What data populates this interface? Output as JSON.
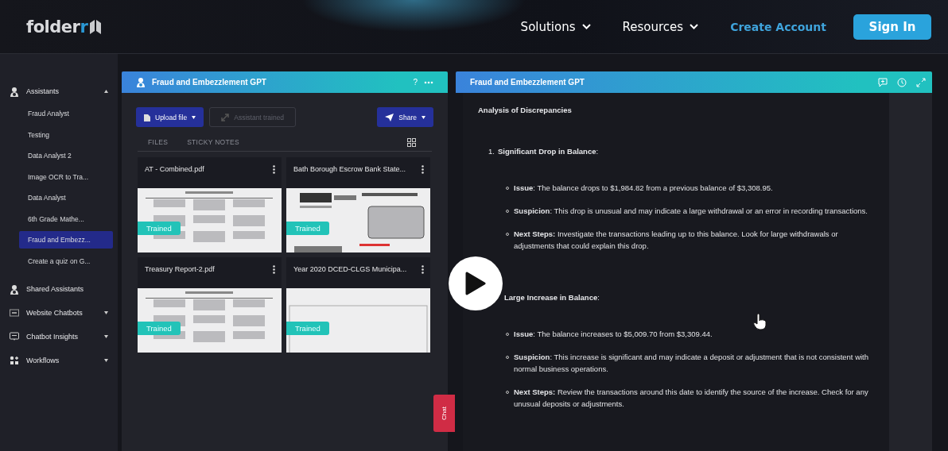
{
  "header": {
    "logo": {
      "text": "folder",
      "accent": "r"
    },
    "nav": [
      {
        "label": "Solutions",
        "dropdown": true
      },
      {
        "label": "Resources",
        "dropdown": true
      }
    ],
    "create_account": "Create Account",
    "sign_in": "Sign In"
  },
  "sidebar": {
    "sections": [
      {
        "label": "Assistants",
        "kind": "person",
        "expanded": true,
        "children": [
          {
            "label": "Fraud Analyst",
            "selected": false
          },
          {
            "label": "Testing",
            "selected": false
          },
          {
            "label": "Data Analyst 2",
            "selected": false
          },
          {
            "label": "Image OCR to Tra...",
            "selected": false
          },
          {
            "label": "Data Analyst",
            "selected": false
          },
          {
            "label": "6th Grade Mathe...",
            "selected": false
          },
          {
            "label": "Fraud and Embezz...",
            "selected": true
          },
          {
            "label": "Create a quiz on G...",
            "selected": false
          }
        ]
      },
      {
        "label": "Shared Assistants",
        "kind": "person"
      },
      {
        "label": "Website Chatbots",
        "kind": "chatbot",
        "expanded": false
      },
      {
        "label": "Chatbot Insights",
        "kind": "insight",
        "expanded": false
      },
      {
        "label": "Workflows",
        "kind": "workflow",
        "expanded": false
      }
    ]
  },
  "left_panel": {
    "title": "Fraud and Embezzlement GPT",
    "help": "?",
    "upload_button": "Upload file",
    "trained_button": {
      "label": "Assistant trained",
      "disabled": true
    },
    "share_button": "Share",
    "tabs": [
      {
        "label": "FILES",
        "selected": false
      },
      {
        "label": "STICKY NOTES",
        "selected": false
      }
    ],
    "files": [
      {
        "name": "AT - Combined.pdf",
        "badge": "Trained"
      },
      {
        "name": "Bath Borough Escrow Bank State...",
        "badge": "Trained"
      },
      {
        "name": "Treasury Report-2.pdf",
        "badge": "Trained"
      },
      {
        "name": "Year 2020 DCED-CLGS Municipa...",
        "badge": "Trained"
      }
    ]
  },
  "right_panel": {
    "title": "Fraud and Embezzlement GPT",
    "heading": "Analysis of Discrepancies",
    "items": [
      {
        "number": "1.",
        "title": "**Significant Drop in Balance**:",
        "points": [
          "**Issue**: The balance drops to $1,984.82 from a previous balance of $3,308.95.",
          "**Suspicion**: This drop is unusual and may indicate a large withdrawal or an error in recording transactions.",
          "**Next Steps:** Investigate the transactions leading up to this balance. Look for large withdrawals or adjustments that could explain this drop."
        ]
      },
      {
        "title": "**Large Increase in Balance**:",
        "points": [
          "**Issue**: The balance increases to $5,009.70 from $3,309.44.",
          "**Suspicion**: This increase is significant and may indicate a deposit or adjustment that is not consistent with normal business operations.",
          "**Next Steps:** Review the transactions around this date to identify the source of the increase. Check for any unusual deposits or adjustments."
        ]
      }
    ]
  },
  "chat_tab": "Chat"
}
